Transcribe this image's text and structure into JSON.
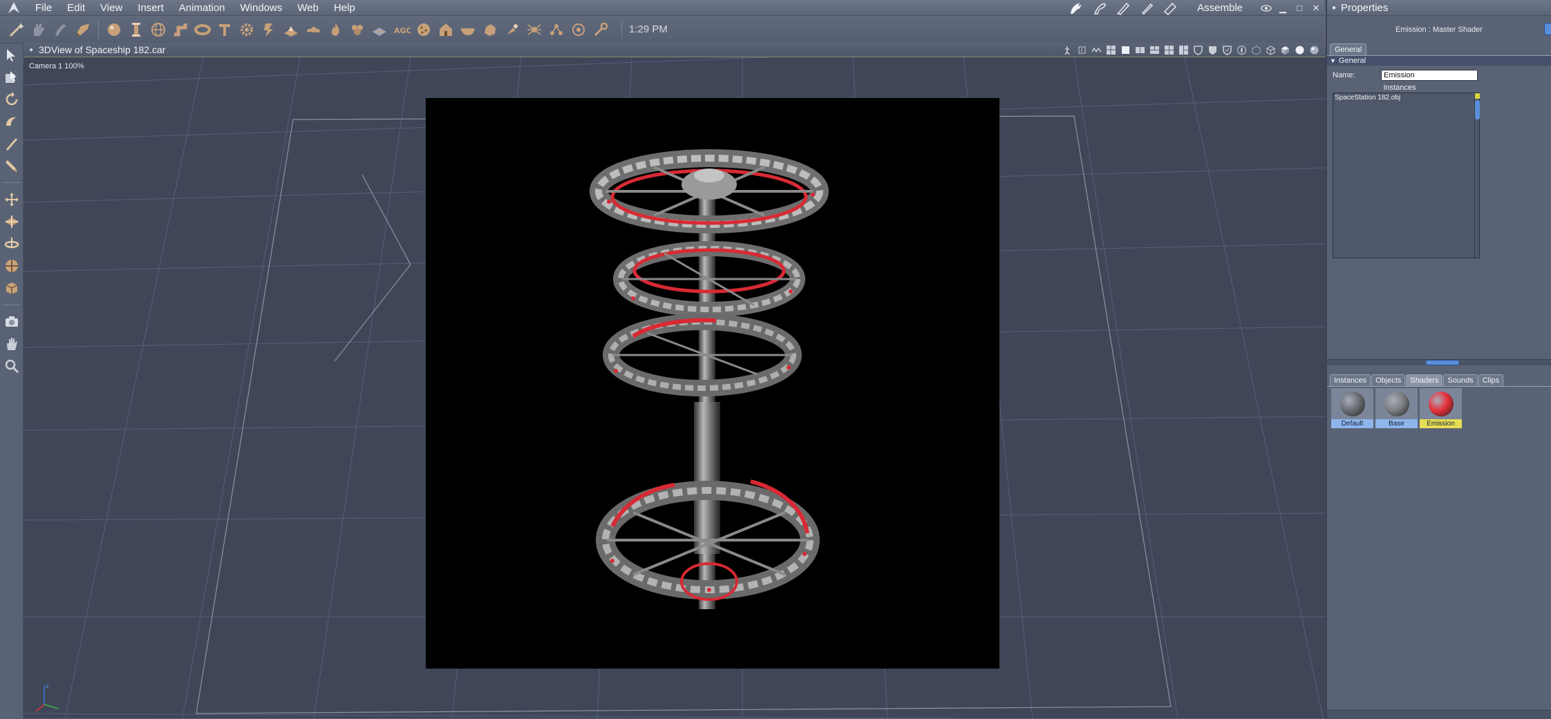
{
  "menubar": {
    "items": [
      "File",
      "Edit",
      "View",
      "Insert",
      "Animation",
      "Windows",
      "Web",
      "Help"
    ],
    "room": "Assemble"
  },
  "toolbar": {
    "time": "1:29 PM"
  },
  "viewport": {
    "title": "3DView of Spaceship 182.car",
    "camera": "Camera 1 100%",
    "render_background": "#000000",
    "accent_red": "#d82a34"
  },
  "properties": {
    "title": "Properties",
    "subtitle": "Emission : Master Shader",
    "tab": "General",
    "section": "General",
    "name_label": "Name:",
    "name_value": "Emission",
    "instances_label": "Instances",
    "instances": [
      "SpaceStation 182.obj"
    ]
  },
  "library": {
    "tabs": [
      "Instances",
      "Objects",
      "Shaders",
      "Sounds",
      "Clips"
    ],
    "active_tab": "Shaders",
    "shaders": [
      {
        "label": "Default",
        "color": "#6b6e73",
        "label_bg": "#8fb6ec"
      },
      {
        "label": "Base",
        "color": "#7c7f84",
        "label_bg": "#8fb6ec"
      },
      {
        "label": "Emission",
        "color": "#e8303a",
        "label_bg": "#e6dd55"
      }
    ]
  }
}
